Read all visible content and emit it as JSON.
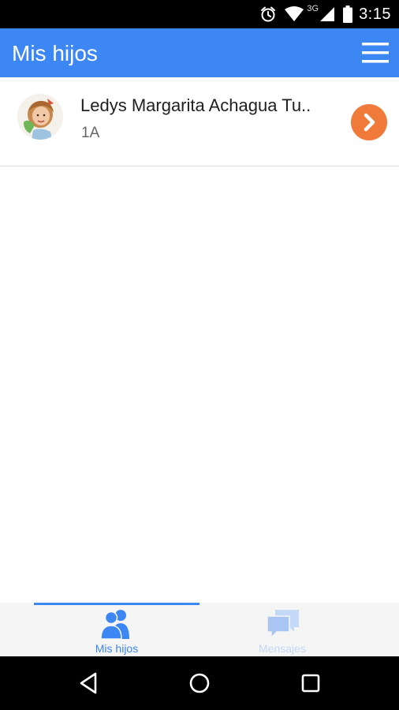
{
  "status_bar": {
    "network": "3G",
    "time": "3:15",
    "icons": [
      "alarm-icon",
      "wifi-icon",
      "cell-signal-icon",
      "battery-icon"
    ]
  },
  "app_bar": {
    "title": "Mis hijos",
    "menu_icon": "hamburger-menu-icon"
  },
  "children": [
    {
      "name": "Ledys Margarita Achagua Tu..",
      "grade": "1A",
      "avatar": "child-photo",
      "action_icon": "chevron-right-icon"
    }
  ],
  "tabs": [
    {
      "label": "Mis hijos",
      "icon": "users-icon",
      "active": true
    },
    {
      "label": "Mensajes",
      "icon": "chat-bubbles-icon",
      "active": false
    }
  ],
  "nav_bar": {
    "icons": [
      "back-icon",
      "home-icon",
      "recents-icon"
    ]
  },
  "colors": {
    "primary": "#3d87f5",
    "accent": "#f07a3a",
    "inactive_tab": "#c4d8f7"
  }
}
